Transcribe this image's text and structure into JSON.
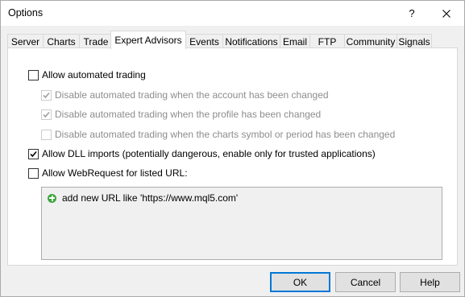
{
  "window": {
    "title": "Options",
    "help_glyph": "?"
  },
  "tabs": [
    {
      "label": "Server"
    },
    {
      "label": "Charts"
    },
    {
      "label": "Trade"
    },
    {
      "label": "Expert Advisors",
      "active": true
    },
    {
      "label": "Events"
    },
    {
      "label": "Notifications"
    },
    {
      "label": "Email"
    },
    {
      "label": "FTP"
    },
    {
      "label": "Community"
    },
    {
      "label": "Signals"
    }
  ],
  "options": {
    "allow_automated": {
      "label": "Allow automated trading",
      "checked": false
    },
    "disable_account": {
      "label": "Disable automated trading when the account has been changed",
      "checked": true,
      "enabled": false
    },
    "disable_profile": {
      "label": "Disable automated trading when the profile has been changed",
      "checked": true,
      "enabled": false
    },
    "disable_symbol": {
      "label": "Disable automated trading when the charts symbol or period has been changed",
      "checked": false,
      "enabled": false
    },
    "allow_dll": {
      "label": "Allow DLL imports (potentially dangerous, enable only for trusted applications)",
      "checked": true
    },
    "allow_webrequest": {
      "label": "Allow WebRequest for listed URL:",
      "checked": false
    }
  },
  "url_list": {
    "add_text": "add new URL like 'https://www.mql5.com'"
  },
  "buttons": {
    "ok": "OK",
    "cancel": "Cancel",
    "help": "Help"
  },
  "colors": {
    "accent": "#0078d7",
    "add_icon": "#3da63d",
    "disabled_text": "#8d8d8d"
  }
}
